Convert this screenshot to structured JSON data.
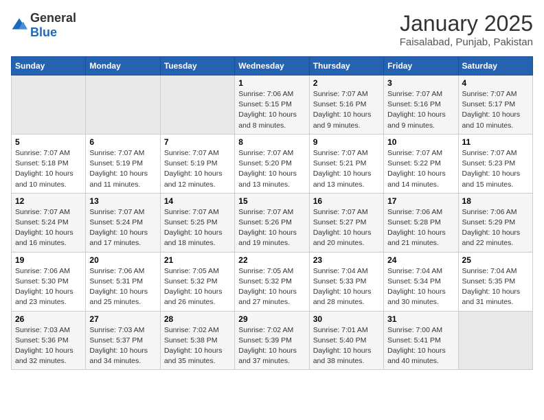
{
  "header": {
    "logo_general": "General",
    "logo_blue": "Blue",
    "title": "January 2025",
    "subtitle": "Faisalabad, Punjab, Pakistan"
  },
  "days_of_week": [
    "Sunday",
    "Monday",
    "Tuesday",
    "Wednesday",
    "Thursday",
    "Friday",
    "Saturday"
  ],
  "weeks": [
    [
      {
        "num": "",
        "info": ""
      },
      {
        "num": "",
        "info": ""
      },
      {
        "num": "",
        "info": ""
      },
      {
        "num": "1",
        "info": "Sunrise: 7:06 AM\nSunset: 5:15 PM\nDaylight: 10 hours\nand 8 minutes."
      },
      {
        "num": "2",
        "info": "Sunrise: 7:07 AM\nSunset: 5:16 PM\nDaylight: 10 hours\nand 9 minutes."
      },
      {
        "num": "3",
        "info": "Sunrise: 7:07 AM\nSunset: 5:16 PM\nDaylight: 10 hours\nand 9 minutes."
      },
      {
        "num": "4",
        "info": "Sunrise: 7:07 AM\nSunset: 5:17 PM\nDaylight: 10 hours\nand 10 minutes."
      }
    ],
    [
      {
        "num": "5",
        "info": "Sunrise: 7:07 AM\nSunset: 5:18 PM\nDaylight: 10 hours\nand 10 minutes."
      },
      {
        "num": "6",
        "info": "Sunrise: 7:07 AM\nSunset: 5:19 PM\nDaylight: 10 hours\nand 11 minutes."
      },
      {
        "num": "7",
        "info": "Sunrise: 7:07 AM\nSunset: 5:19 PM\nDaylight: 10 hours\nand 12 minutes."
      },
      {
        "num": "8",
        "info": "Sunrise: 7:07 AM\nSunset: 5:20 PM\nDaylight: 10 hours\nand 13 minutes."
      },
      {
        "num": "9",
        "info": "Sunrise: 7:07 AM\nSunset: 5:21 PM\nDaylight: 10 hours\nand 13 minutes."
      },
      {
        "num": "10",
        "info": "Sunrise: 7:07 AM\nSunset: 5:22 PM\nDaylight: 10 hours\nand 14 minutes."
      },
      {
        "num": "11",
        "info": "Sunrise: 7:07 AM\nSunset: 5:23 PM\nDaylight: 10 hours\nand 15 minutes."
      }
    ],
    [
      {
        "num": "12",
        "info": "Sunrise: 7:07 AM\nSunset: 5:24 PM\nDaylight: 10 hours\nand 16 minutes."
      },
      {
        "num": "13",
        "info": "Sunrise: 7:07 AM\nSunset: 5:24 PM\nDaylight: 10 hours\nand 17 minutes."
      },
      {
        "num": "14",
        "info": "Sunrise: 7:07 AM\nSunset: 5:25 PM\nDaylight: 10 hours\nand 18 minutes."
      },
      {
        "num": "15",
        "info": "Sunrise: 7:07 AM\nSunset: 5:26 PM\nDaylight: 10 hours\nand 19 minutes."
      },
      {
        "num": "16",
        "info": "Sunrise: 7:07 AM\nSunset: 5:27 PM\nDaylight: 10 hours\nand 20 minutes."
      },
      {
        "num": "17",
        "info": "Sunrise: 7:06 AM\nSunset: 5:28 PM\nDaylight: 10 hours\nand 21 minutes."
      },
      {
        "num": "18",
        "info": "Sunrise: 7:06 AM\nSunset: 5:29 PM\nDaylight: 10 hours\nand 22 minutes."
      }
    ],
    [
      {
        "num": "19",
        "info": "Sunrise: 7:06 AM\nSunset: 5:30 PM\nDaylight: 10 hours\nand 23 minutes."
      },
      {
        "num": "20",
        "info": "Sunrise: 7:06 AM\nSunset: 5:31 PM\nDaylight: 10 hours\nand 25 minutes."
      },
      {
        "num": "21",
        "info": "Sunrise: 7:05 AM\nSunset: 5:32 PM\nDaylight: 10 hours\nand 26 minutes."
      },
      {
        "num": "22",
        "info": "Sunrise: 7:05 AM\nSunset: 5:32 PM\nDaylight: 10 hours\nand 27 minutes."
      },
      {
        "num": "23",
        "info": "Sunrise: 7:04 AM\nSunset: 5:33 PM\nDaylight: 10 hours\nand 28 minutes."
      },
      {
        "num": "24",
        "info": "Sunrise: 7:04 AM\nSunset: 5:34 PM\nDaylight: 10 hours\nand 30 minutes."
      },
      {
        "num": "25",
        "info": "Sunrise: 7:04 AM\nSunset: 5:35 PM\nDaylight: 10 hours\nand 31 minutes."
      }
    ],
    [
      {
        "num": "26",
        "info": "Sunrise: 7:03 AM\nSunset: 5:36 PM\nDaylight: 10 hours\nand 32 minutes."
      },
      {
        "num": "27",
        "info": "Sunrise: 7:03 AM\nSunset: 5:37 PM\nDaylight: 10 hours\nand 34 minutes."
      },
      {
        "num": "28",
        "info": "Sunrise: 7:02 AM\nSunset: 5:38 PM\nDaylight: 10 hours\nand 35 minutes."
      },
      {
        "num": "29",
        "info": "Sunrise: 7:02 AM\nSunset: 5:39 PM\nDaylight: 10 hours\nand 37 minutes."
      },
      {
        "num": "30",
        "info": "Sunrise: 7:01 AM\nSunset: 5:40 PM\nDaylight: 10 hours\nand 38 minutes."
      },
      {
        "num": "31",
        "info": "Sunrise: 7:00 AM\nSunset: 5:41 PM\nDaylight: 10 hours\nand 40 minutes."
      },
      {
        "num": "",
        "info": ""
      }
    ]
  ]
}
